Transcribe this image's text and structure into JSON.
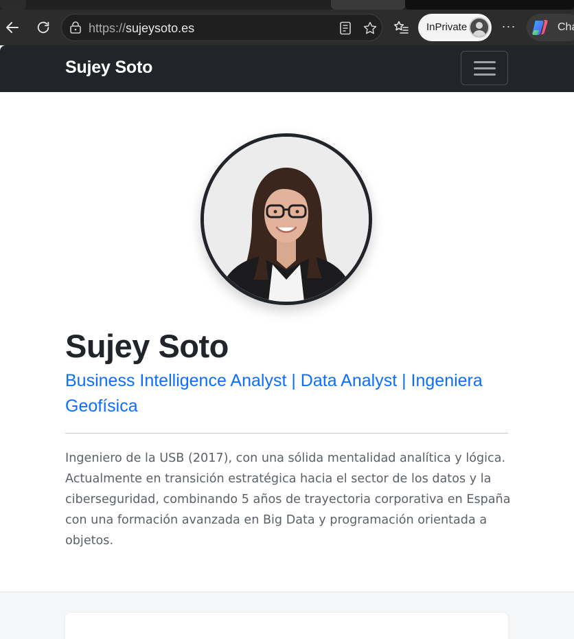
{
  "browser": {
    "url_protocol": "https://",
    "url_host": "sujeysoto.es",
    "inprivate_label": "InPrivate",
    "more_label": "···",
    "copilot_label": "Cha",
    "icons": [
      "back-arrow-icon",
      "refresh-icon",
      "lock-icon",
      "reader-mode-icon",
      "favorite-star-icon",
      "favorites-list-icon",
      "profile-avatar-icon",
      "more-options-icon",
      "copilot-logo-icon"
    ]
  },
  "navbar": {
    "brand": "Sujey Soto",
    "toggler_icon": "hamburger-menu-icon"
  },
  "hero": {
    "photo_alt": "Sujey Soto",
    "name": "Sujey Soto",
    "role_line1": "Business Intelligence Analyst | Data Analyst | Ingeniera",
    "role_line2": "Geofísica",
    "bio_lines": [
      "Ingeniero de la USB (2017), con una sólida mentalidad analítica y lógica.",
      "Actualmente en transición estratégica hacia el sector de los datos y la",
      "ciberseguridad, combinando 5 años de trayectoria corporativa en España",
      "con una formación avanzada en Big Data y programación orientada a",
      "objetos."
    ]
  },
  "colors": {
    "navbar_bg": "#212529",
    "accent": "#0d6efd",
    "text_dark": "#212529",
    "text_muted": "#5b6167",
    "section_bg": "#f5f6f8"
  }
}
